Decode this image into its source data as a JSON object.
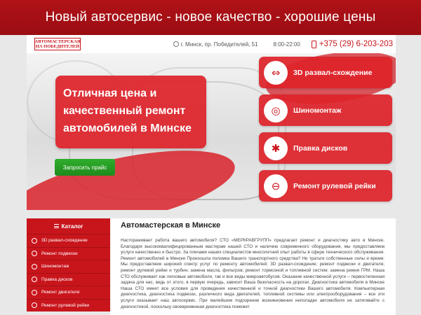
{
  "banner": {
    "title": "Новый автосервис - новое качество - хорошие цены"
  },
  "header": {
    "logo_line1": "АВТОМАСТЕРСКАЯ",
    "logo_line2": "НА ПОБЕДИТЕЛЕЙ",
    "address": "г. Минск, пр. Победителей, 51",
    "hours": "8:00-22:00",
    "phone": "+375 (29) 6-203-203",
    "icons": {
      "address": "location-pin-icon",
      "phone": "mobile-phone-icon"
    }
  },
  "hero": {
    "promo_line1": "Отличная цена и",
    "promo_line2": "качественный ремонт",
    "promo_line3": "автомобилей в Минске",
    "cta_label": "Запросить прайс",
    "services": [
      {
        "label": "3D развал-схождение",
        "icon": "wheel-alignment-icon"
      },
      {
        "label": "Шиномонтаж",
        "icon": "tire-icon"
      },
      {
        "label": "Правка дисков",
        "icon": "rim-icon"
      },
      {
        "label": "Ремонт рулевой рейки",
        "icon": "steering-wheel-icon"
      }
    ]
  },
  "sidebar": {
    "title": "Каталог",
    "items": [
      {
        "label": "3D развал-схождение"
      },
      {
        "label": "Ремонт подвески"
      },
      {
        "label": "Шиномонтаж"
      },
      {
        "label": "Правка дисков"
      },
      {
        "label": "Ремонт двигателя"
      },
      {
        "label": "Ремонт рулевой рейки"
      }
    ]
  },
  "main": {
    "title": "Автомастерская в Минске",
    "body": "Настораживает работа вашего автомобиля? СТО «МЕРКРАВГРУПП» предлагает ремонт и диагностику авто в Минске. Благодаря высококвалифицированным мастерам нашей СТО и наличию современного оборудования, мы предоставляем услуги качественно и быстро. За плечами наших специалистов многолетний опыт работы в сфере технического обслуживания. Ремонт автомобилей в Минске Произошла поломка Вашего транспортного средства? Не тратьте собственные силы и время. Мы предоставляем широкий спектр услуг по ремонту автомобилей: 3D развал-схождение; ремонт подвески и двигателя; ремонт рулевой рейки и турбин; замена масла, фильтров; ремонт тормозной и топливной систем; замена ремня ГРМ. Наша СТО обслуживает как легковые автомобили, так и все виды микроавтобусов. Оказание качественной услуги – первостепенная задача для нас, ведь от этого, в первую очередь, зависит Ваша безопасность на дорогах. Диагностика автомобиля в Минске Наша СТО имеет все условия для проведения качественной и точной диагностики Вашего автомобиля. Компьютерная диагностика, диагностика подвески, различного вида двигателей, топливной системы или электрооборудования – все эти услуги оказывает наш автосервис. При малейшем подозрении возникновения неполадки автомобиля не затягивайте с диагностикой, поскольку своевременная диагностика поможет"
  }
}
